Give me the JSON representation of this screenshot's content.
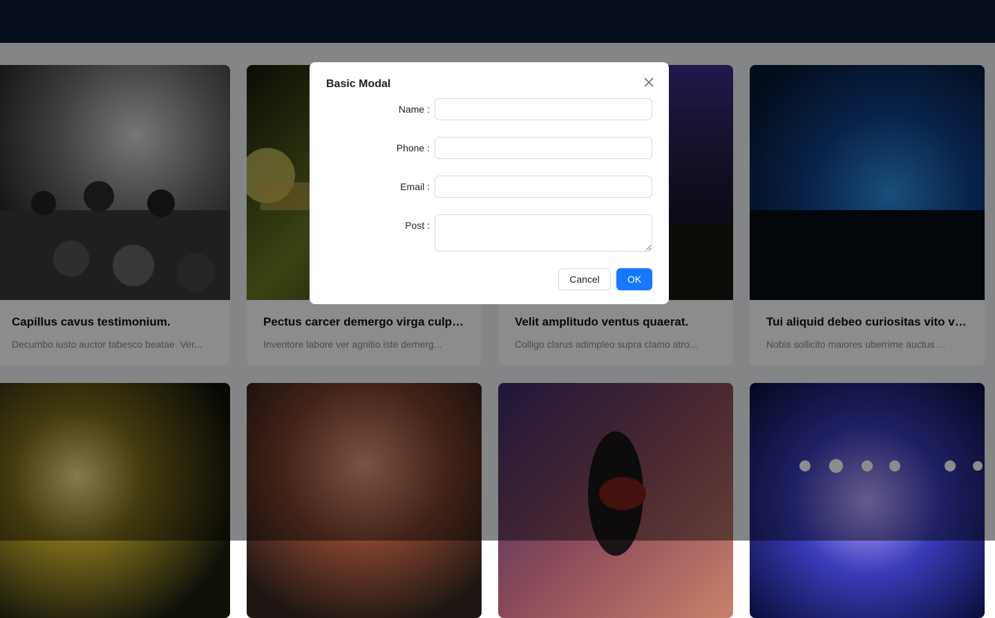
{
  "cards": [
    {
      "title": "Capillus cavus testimonium.",
      "description": "Decumbo iusto auctor tabesco beatae. Ver..."
    },
    {
      "title": "Pectus carcer demergo virga culpo ...",
      "description": "Inventore labore ver agnitio iste demerg..."
    },
    {
      "title": "Velit amplitudo ventus quaerat.",
      "description": "Colligo clarus adimpleo supra clamo atro..."
    },
    {
      "title": "Tui aliquid debeo curiositas vito vert...",
      "description": "Nobis sollicito maiores uberrime auctus ..."
    }
  ],
  "modal": {
    "title": "Basic Modal",
    "fields": [
      {
        "label": "Name",
        "value": ""
      },
      {
        "label": "Phone",
        "value": ""
      },
      {
        "label": "Email",
        "value": ""
      },
      {
        "label": "Post",
        "value": ""
      }
    ],
    "cancel_label": "Cancel",
    "ok_label": "OK"
  },
  "colors": {
    "primary": "#1677ff",
    "overlay": "rgba(0,0,0,0.45)",
    "header": "#0e1a33"
  },
  "icons": {
    "close": "close-icon"
  }
}
